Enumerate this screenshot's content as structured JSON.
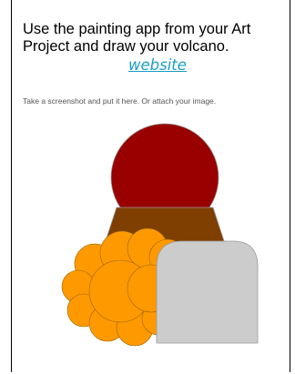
{
  "document": {
    "heading": "Use the painting app from your Art Project and draw your volcano.",
    "link_text": "website",
    "instructions": "Take a screenshot and put it here. Or attach your image."
  },
  "drawing": {
    "description_icons": [
      "lava-blob-shape",
      "volcano-shape",
      "smoke-cloud-shape",
      "rock-shape"
    ],
    "colors": {
      "lava": "#990000",
      "volcano": "#7f3f00",
      "smoke": "#ff9900",
      "rock": "#cccccc",
      "outline": "#999999"
    }
  }
}
